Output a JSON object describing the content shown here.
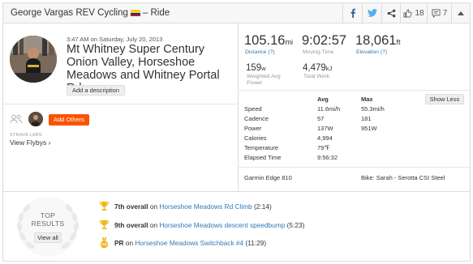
{
  "header": {
    "athlete": "George Vargas REV Cycling",
    "separator": "– Ride",
    "kudos_count": "18",
    "comment_count": "7"
  },
  "activity": {
    "date": "3:47 AM on Saturday, July 20, 2013",
    "title": "Mt Whitney Super Century Onion Valley, Horseshoe Meadows and Whitney Portal Rd",
    "add_description": "Add a description",
    "add_others": "Add Others",
    "strava_labs": "STRAVA LABS",
    "view_flybys": "View Flybys ›"
  },
  "stats": {
    "distance": {
      "value": "105.16",
      "unit": "mi",
      "label": "Distance (?)"
    },
    "moving_time": {
      "value": "9:02:57",
      "label": "Moving Time"
    },
    "elevation": {
      "value": "18,061",
      "unit": "ft",
      "label": "Elevation (?)"
    },
    "weighted_power": {
      "value": "159",
      "unit": "w",
      "label": "Weighted Avg Power"
    },
    "total_work": {
      "value": "4,479",
      "unit": "kJ",
      "label": "Total Work"
    }
  },
  "table": {
    "col_avg": "Avg",
    "col_max": "Max",
    "show_less": "Show Less",
    "rows": [
      {
        "name": "Speed",
        "avg": "11.6mi/h",
        "max": "55.3mi/h"
      },
      {
        "name": "Cadence",
        "avg": "57",
        "max": "181"
      },
      {
        "name": "Power",
        "avg": "137W",
        "max": "951W"
      },
      {
        "name": "Calories",
        "avg": "4,994",
        "max": ""
      },
      {
        "name": "Temperature",
        "avg": "79℉",
        "max": ""
      },
      {
        "name": "Elapsed Time",
        "avg": "9:56:32",
        "max": ""
      }
    ],
    "device": "Garmin Edge 810",
    "bike": "Bike: Sarah - Serotta CSI Steel"
  },
  "results": {
    "title_line1": "TOP",
    "title_line2": "RESULTS",
    "view_all": "View all",
    "items": [
      {
        "rank": "7th overall",
        "on": "on",
        "segment": "Horseshoe Meadows Rd Climb",
        "time": "(2:14)",
        "icon": "trophy-icon"
      },
      {
        "rank": "9th overall",
        "on": "on",
        "segment": "Horseshoe Meadows descent speedbump",
        "time": "(5:23)",
        "icon": "trophy-icon"
      },
      {
        "rank": "PR",
        "on": "on",
        "segment": "Horseshoe Meadows Switchback #4",
        "time": "(11:29)",
        "icon": "pr-medal-icon"
      }
    ]
  },
  "colors": {
    "accent_orange": "#fc5200",
    "link_blue": "#2e7ab8",
    "trophy_gold": "#f2b51c"
  }
}
